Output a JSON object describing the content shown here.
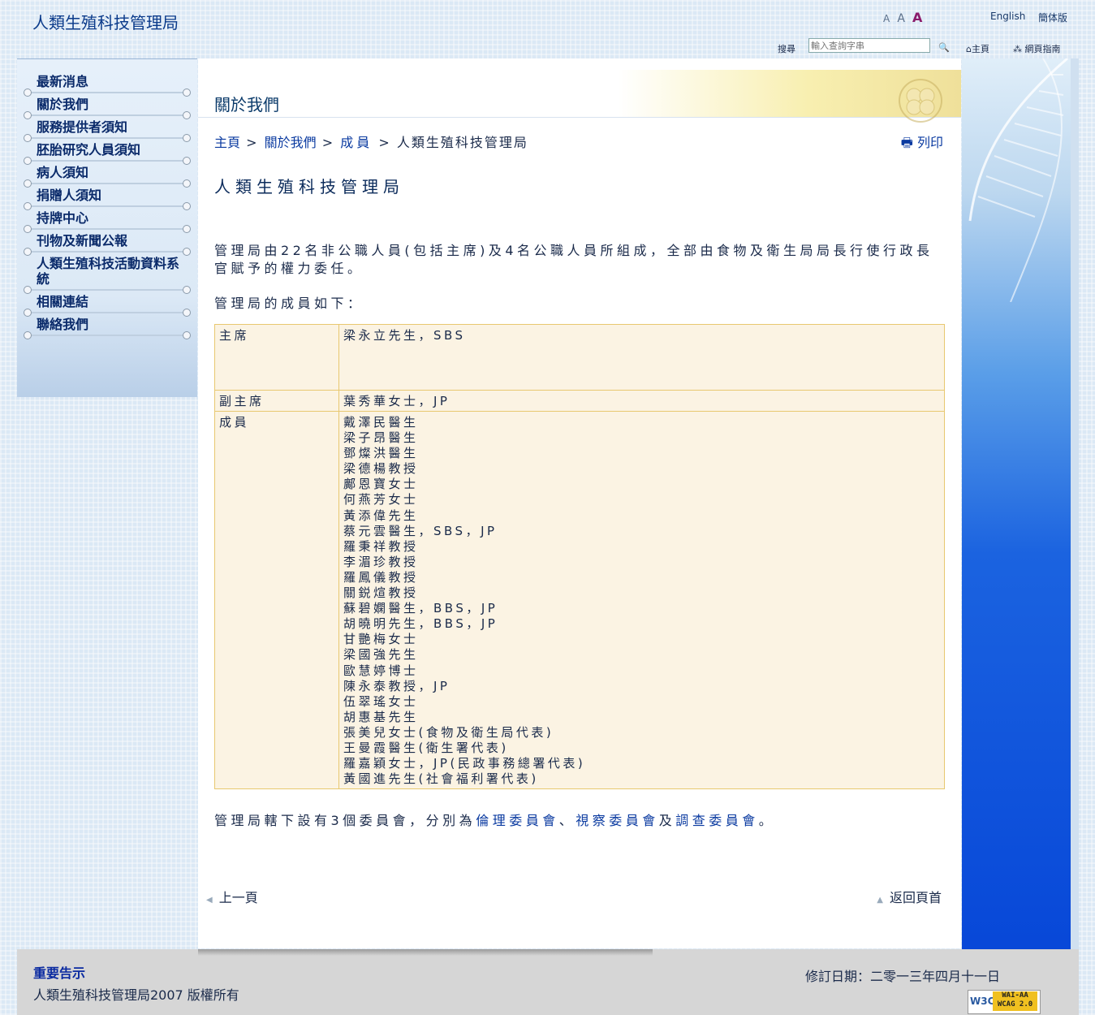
{
  "header": {
    "site_title": "人類生殖科技管理局",
    "font_sizes": [
      "A",
      "A",
      "A"
    ],
    "lang_english": "English",
    "lang_simplified": "簡体版",
    "search_label": "搜尋",
    "search_placeholder": "輸入查詢字串",
    "search_icon": "magnifier-icon",
    "home_link": "主頁",
    "sitemap_link": "網頁指南"
  },
  "sidebar": {
    "items": [
      {
        "label": "最新消息"
      },
      {
        "label": "關於我們"
      },
      {
        "label": "服務提供者須知"
      },
      {
        "label": "胚胎研究人員須知"
      },
      {
        "label": "病人須知"
      },
      {
        "label": "捐贈人須知"
      },
      {
        "label": "持牌中心"
      },
      {
        "label": "刊物及新聞公報"
      },
      {
        "label": "人類生殖科技活動資料系統"
      },
      {
        "label": "相關連結"
      },
      {
        "label": "聯絡我們"
      }
    ]
  },
  "main": {
    "section_title": "關於我們",
    "breadcrumb": {
      "home": "主頁",
      "sep": ">",
      "about": "關於我們",
      "members": "成員",
      "current": "人類生殖科技管理局"
    },
    "print_label": "列印",
    "page_title": "人類生殖科技管理局",
    "intro": "管理局由22名非公職人員(包括主席)及4名公職人員所組成，全部由食物及衛生局局長行使行政長官賦予的權力委任。",
    "members_intro": "管理局的成員如下：",
    "table": {
      "chair_role": "主席",
      "chair_name": "梁永立先生，SBS",
      "vice_role": "副主席",
      "vice_name": "葉秀華女士，JP",
      "members_role": "成員",
      "members": [
        "戴澤民醫生",
        "梁子昂醫生",
        "鄧燦洪醫生",
        "梁德楊教授",
        "鄺恩寶女士",
        "何燕芳女士",
        "黃添偉先生",
        "蔡元雲醫生，SBS，JP",
        "羅秉祥教授",
        "李湄珍教授",
        "羅鳳儀教授",
        "關鋭煊教授",
        "蘇碧嫻醫生，BBS，JP",
        "胡曉明先生，BBS，JP",
        "甘艷梅女士",
        "梁國強先生",
        "歐慧婷博士",
        "陳永泰教授，JP",
        "伍翠瑤女士",
        "胡惠基先生",
        "張美兒女士(食物及衛生局代表)",
        "王曼霞醫生(衛生署代表)",
        "羅嘉穎女士，JP(民政事務總署代表)",
        "黃國進先生(社會福利署代表)"
      ]
    },
    "committees": {
      "prefix": "管理局轄下設有3個委員會，分別為",
      "c1": "倫理委員會",
      "sep1": "、",
      "c2": "視察委員會",
      "sep2": "及",
      "c3": "調查委員會",
      "suffix": "。"
    },
    "prev_label": "上一頁",
    "top_label": "返回頁首"
  },
  "footer": {
    "notice": "重要告示",
    "copyright": "人類生殖科技管理局2007 版權所有",
    "revised": "修訂日期：二零一三年四月十一日",
    "badge_w3c": "W3C",
    "badge_line1": "WAI-AA",
    "badge_line2": "WCAG 2.0"
  },
  "colors": {
    "link": "#0a3aa0",
    "table_border": "#e8c870",
    "table_bg": "#fbf3e3"
  }
}
